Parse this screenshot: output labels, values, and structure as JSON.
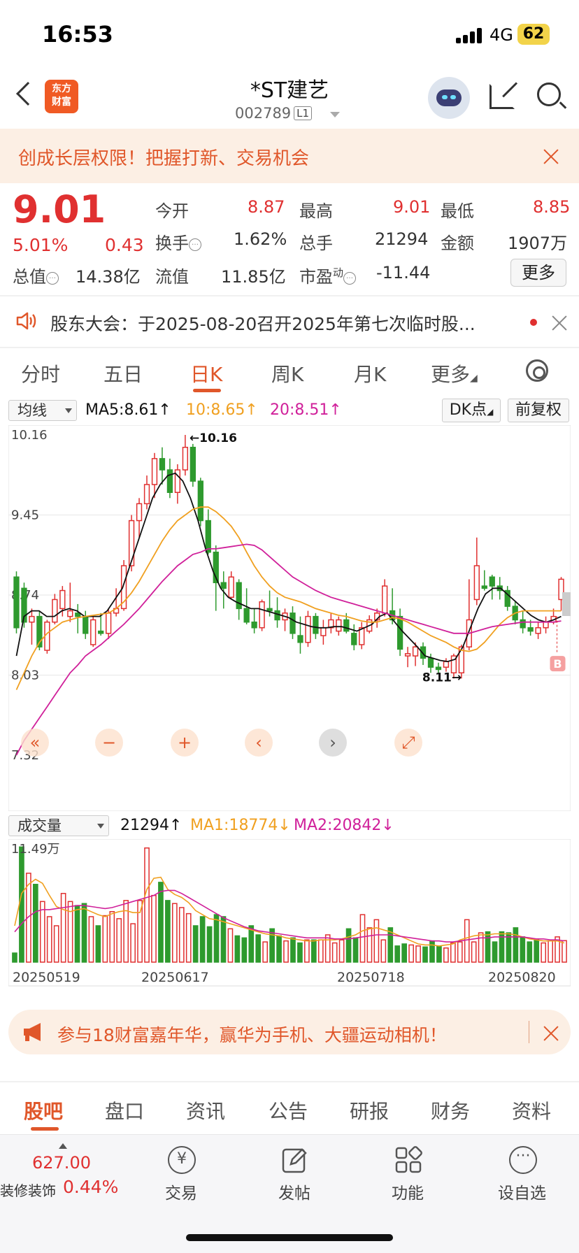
{
  "status_bar": {
    "time": "16:53",
    "network": "4G",
    "battery": "62"
  },
  "header": {
    "logo_line1": "东方",
    "logo_line2": "财富",
    "title": "*ST建艺",
    "code": "002789",
    "level": "L1"
  },
  "banner": {
    "text": "创成长层权限！把握打新、交易机会"
  },
  "quote": {
    "price": "9.01",
    "change_pct": "5.01%",
    "change": "0.43",
    "open_label": "今开",
    "open": "8.87",
    "high_label": "最高",
    "high": "9.01",
    "low_label": "最低",
    "low": "8.85",
    "turnover_label": "换手",
    "turnover": "1.62%",
    "volume_label": "总手",
    "volume": "21294",
    "amount_label": "金额",
    "amount": "1907万",
    "mktcap_label": "总值",
    "mktcap": "14.38亿",
    "float_label": "流值",
    "float": "11.85亿",
    "pe_label": "市盈",
    "pe_sup": "动",
    "pe": "-11.44",
    "more_label": "更多"
  },
  "notice": {
    "text": "股东大会：于2025-08-20召开2025年第七次临时股..."
  },
  "chart_tabs": {
    "items": [
      "分时",
      "五日",
      "日K",
      "周K",
      "月K",
      "更多"
    ],
    "active": "日K"
  },
  "ma_bar": {
    "selector": "均线",
    "ma5": "MA5:8.61↑",
    "ma10": "10:8.65↑",
    "ma20": "20:8.51↑",
    "dk_button": "DK点",
    "adjust_button": "前复权",
    "colors": {
      "ma5": "#111111",
      "ma10": "#f0a020",
      "ma20": "#d0209a",
      "up": "#e03030",
      "down": "#2e9a2e"
    }
  },
  "chart_data": [
    {
      "type": "candlestick",
      "y_ticks": [
        "10.16",
        "9.45",
        "8.74",
        "8.03",
        "7.32"
      ],
      "ylim": [
        7.32,
        10.16
      ],
      "annotations": {
        "high_label": "←10.16",
        "low_label": "8.11→",
        "signal": "B"
      },
      "controls": [
        "«",
        "−",
        "+",
        "‹",
        "›",
        "⤢"
      ],
      "candles": [
        [
          8.9,
          8.95,
          8.4,
          8.45
        ],
        [
          8.8,
          8.85,
          8.45,
          8.5
        ],
        [
          8.5,
          8.62,
          8.3,
          8.55
        ],
        [
          8.55,
          8.6,
          8.25,
          8.28
        ],
        [
          8.25,
          8.52,
          8.22,
          8.5
        ],
        [
          8.5,
          8.75,
          8.48,
          8.7
        ],
        [
          8.62,
          8.82,
          8.55,
          8.78
        ],
        [
          8.55,
          8.85,
          8.5,
          8.6
        ],
        [
          8.58,
          8.66,
          8.4,
          8.55
        ],
        [
          8.55,
          8.6,
          8.35,
          8.4
        ],
        [
          8.3,
          8.55,
          8.28,
          8.52
        ],
        [
          8.42,
          8.58,
          8.38,
          8.4
        ],
        [
          8.4,
          8.62,
          8.35,
          8.58
        ],
        [
          8.58,
          8.8,
          8.55,
          8.62
        ],
        [
          8.62,
          9.05,
          8.6,
          9.0
        ],
        [
          9.0,
          9.45,
          8.95,
          9.4
        ],
        [
          9.4,
          9.6,
          9.25,
          9.55
        ],
        [
          9.55,
          9.8,
          9.5,
          9.72
        ],
        [
          9.72,
          10.0,
          9.6,
          9.95
        ],
        [
          9.95,
          10.05,
          9.72,
          9.85
        ],
        [
          9.85,
          9.95,
          9.6,
          9.65
        ],
        [
          9.65,
          9.9,
          9.55,
          9.85
        ],
        [
          9.85,
          10.16,
          9.8,
          10.05
        ],
        [
          10.05,
          10.08,
          9.7,
          9.75
        ],
        [
          9.75,
          9.78,
          9.35,
          9.4
        ],
        [
          9.4,
          9.5,
          9.1,
          9.12
        ],
        [
          9.12,
          9.18,
          8.6,
          8.85
        ],
        [
          8.85,
          8.95,
          8.62,
          8.8
        ],
        [
          8.72,
          8.95,
          8.7,
          8.9
        ],
        [
          8.85,
          8.88,
          8.52,
          8.62
        ],
        [
          8.62,
          8.8,
          8.48,
          8.5
        ],
        [
          8.5,
          8.62,
          8.4,
          8.45
        ],
        [
          8.45,
          8.7,
          8.42,
          8.68
        ],
        [
          8.62,
          8.78,
          8.55,
          8.6
        ],
        [
          8.6,
          8.72,
          8.45,
          8.52
        ],
        [
          8.52,
          8.62,
          8.42,
          8.58
        ],
        [
          8.58,
          8.64,
          8.35,
          8.4
        ],
        [
          8.38,
          8.55,
          8.22,
          8.32
        ],
        [
          8.32,
          8.6,
          8.28,
          8.55
        ],
        [
          8.55,
          8.58,
          8.35,
          8.4
        ],
        [
          8.38,
          8.52,
          8.3,
          8.45
        ],
        [
          8.45,
          8.58,
          8.4,
          8.52
        ],
        [
          8.42,
          8.55,
          8.38,
          8.52
        ],
        [
          8.52,
          8.58,
          8.4,
          8.42
        ],
        [
          8.4,
          8.48,
          8.25,
          8.3
        ],
        [
          8.3,
          8.5,
          8.26,
          8.45
        ],
        [
          8.42,
          8.56,
          8.4,
          8.52
        ],
        [
          8.52,
          8.62,
          8.45,
          8.58
        ],
        [
          8.58,
          8.88,
          8.55,
          8.82
        ],
        [
          8.6,
          8.8,
          8.48,
          8.52
        ],
        [
          8.55,
          8.62,
          8.2,
          8.26
        ],
        [
          8.2,
          8.28,
          8.1,
          8.22
        ],
        [
          8.2,
          8.32,
          8.11,
          8.28
        ],
        [
          8.28,
          8.32,
          8.12,
          8.18
        ],
        [
          8.18,
          8.22,
          8.05,
          8.1
        ],
        [
          8.1,
          8.14,
          8.05,
          8.08
        ],
        [
          8.1,
          8.18,
          8.06,
          8.15
        ],
        [
          8.05,
          8.22,
          8.0,
          8.2
        ],
        [
          8.05,
          8.3,
          8.0,
          8.28
        ],
        [
          8.28,
          8.88,
          8.25,
          8.52
        ],
        [
          8.7,
          9.25,
          8.65,
          9.0
        ],
        [
          8.82,
          8.96,
          8.78,
          8.8
        ],
        [
          8.9,
          8.92,
          8.7,
          8.82
        ],
        [
          8.82,
          8.9,
          8.7,
          8.78
        ],
        [
          8.78,
          8.82,
          8.6,
          8.64
        ],
        [
          8.64,
          8.68,
          8.48,
          8.52
        ],
        [
          8.52,
          8.6,
          8.4,
          8.45
        ],
        [
          8.45,
          8.52,
          8.38,
          8.42
        ],
        [
          8.4,
          8.5,
          8.35,
          8.45
        ],
        [
          8.45,
          8.55,
          8.4,
          8.5
        ],
        [
          8.5,
          8.62,
          8.48,
          8.55
        ],
        [
          8.7,
          8.9,
          8.6,
          8.88
        ]
      ],
      "series": [
        {
          "name": "MA5",
          "values": [
            8.2,
            8.55,
            8.6,
            8.6,
            8.55,
            8.55,
            8.6,
            8.62,
            8.6,
            8.55,
            8.55,
            8.55,
            8.6,
            8.7,
            8.8,
            9.0,
            9.2,
            9.4,
            9.6,
            9.72,
            9.8,
            9.82,
            9.75,
            9.6,
            9.4,
            9.15,
            8.95,
            8.8,
            8.72,
            8.68,
            8.65,
            8.62,
            8.62,
            8.6,
            8.58,
            8.56,
            8.54,
            8.5,
            8.48,
            8.46,
            8.45,
            8.45,
            8.46,
            8.46,
            8.44,
            8.42,
            8.45,
            8.48,
            8.55,
            8.58,
            8.5,
            8.42,
            8.35,
            8.28,
            8.2,
            8.18,
            8.16,
            8.15,
            8.17,
            8.28,
            8.45,
            8.62,
            8.75,
            8.8,
            8.8,
            8.74,
            8.68,
            8.62,
            8.56,
            8.52,
            8.5,
            8.52,
            8.55
          ]
        },
        {
          "name": "MA10",
          "values": [
            7.9,
            8.05,
            8.2,
            8.32,
            8.4,
            8.45,
            8.5,
            8.52,
            8.54,
            8.55,
            8.56,
            8.57,
            8.58,
            8.62,
            8.68,
            8.76,
            8.86,
            8.98,
            9.1,
            9.22,
            9.32,
            9.4,
            9.45,
            9.5,
            9.52,
            9.52,
            9.48,
            9.42,
            9.35,
            9.25,
            9.12,
            9.0,
            8.9,
            8.82,
            8.76,
            8.72,
            8.7,
            8.68,
            8.65,
            8.62,
            8.6,
            8.58,
            8.56,
            8.55,
            8.53,
            8.51,
            8.5,
            8.5,
            8.52,
            8.54,
            8.53,
            8.5,
            8.46,
            8.42,
            8.38,
            8.35,
            8.32,
            8.28,
            8.25,
            8.24,
            8.26,
            8.32,
            8.4,
            8.48,
            8.54,
            8.58,
            8.6,
            8.6,
            8.6,
            8.6,
            8.6,
            8.6
          ]
        },
        {
          "name": "MA20",
          "values": [
            7.32,
            7.45,
            7.55,
            7.65,
            7.75,
            7.85,
            7.95,
            8.05,
            8.12,
            8.2,
            8.25,
            8.3,
            8.36,
            8.42,
            8.48,
            8.55,
            8.62,
            8.7,
            8.78,
            8.86,
            8.93,
            9.0,
            9.05,
            9.1,
            9.12,
            9.15,
            9.15,
            9.16,
            9.17,
            9.18,
            9.19,
            9.18,
            9.14,
            9.08,
            9.02,
            8.96,
            8.9,
            8.86,
            8.82,
            8.78,
            8.75,
            8.72,
            8.7,
            8.68,
            8.66,
            8.64,
            8.62,
            8.6,
            8.58,
            8.56,
            8.54,
            8.52,
            8.5,
            8.48,
            8.46,
            8.44,
            8.42,
            8.4,
            8.4,
            8.4,
            8.42,
            8.44,
            8.46,
            8.47,
            8.48,
            8.49,
            8.5,
            8.5,
            8.5,
            8.5,
            8.5,
            8.51
          ]
        }
      ]
    },
    {
      "type": "bar",
      "title": "成交量",
      "legend": {
        "volume": "21294↑",
        "ma1": "MA1:18774↓",
        "ma2": "MA2:20842↓"
      },
      "y_tick": "11.49万",
      "ylim": [
        0,
        114900
      ],
      "x_ticks": [
        "20250519",
        "20250617",
        "20250718",
        "20250820"
      ],
      "values": [
        9000,
        114000,
        88000,
        77000,
        60000,
        45000,
        36000,
        68000,
        60000,
        56000,
        58000,
        45000,
        36000,
        46000,
        50000,
        43000,
        61000,
        38000,
        61000,
        113000,
        66000,
        79000,
        61000,
        58000,
        54000,
        48000,
        36000,
        45000,
        35000,
        47000,
        45000,
        33000,
        26000,
        24000,
        36000,
        27000,
        20000,
        33000,
        26000,
        21000,
        24000,
        19000,
        22000,
        22000,
        22000,
        27000,
        19000,
        22000,
        33000,
        24000,
        47000,
        34000,
        42000,
        22000,
        34000,
        16000,
        18000,
        17000,
        16000,
        15000,
        21000,
        16000,
        14000,
        19000,
        20000,
        42000,
        20000,
        29000,
        30000,
        20000,
        30000,
        29000,
        34000,
        25000,
        20000,
        22000,
        19000,
        21000,
        25000,
        21294
      ],
      "series": [
        {
          "name": "MA1",
          "values": [
            36000,
            68000,
            77000,
            82000,
            78000,
            66000,
            55000,
            52000,
            50000,
            52000,
            53000,
            50000,
            47000,
            45000,
            48000,
            50000,
            51000,
            49000,
            49000,
            72000,
            83000,
            84000,
            72000,
            67000,
            64000,
            59000,
            51000,
            47000,
            43000,
            42000,
            40000,
            38000,
            36000,
            34000,
            32000,
            30000,
            28000,
            27000,
            26000,
            24000,
            23000,
            22000,
            21000,
            21000,
            22000,
            22000,
            22000,
            23000,
            25000,
            27000,
            31000,
            33000,
            34000,
            32000,
            30000,
            27000,
            24000,
            21000,
            18000,
            17000,
            17000,
            16000,
            17000,
            18000,
            22000,
            24000,
            26000,
            27000,
            27000,
            28000,
            28000,
            28000,
            27000,
            25000,
            23000,
            22000,
            21000,
            21000,
            21000,
            19000
          ]
        },
        {
          "name": "MA2",
          "values": [
            30000,
            38000,
            45000,
            50000,
            52000,
            52000,
            53000,
            54000,
            55000,
            56000,
            56000,
            55000,
            54000,
            53000,
            54000,
            56000,
            58000,
            60000,
            62000,
            64000,
            66000,
            70000,
            71000,
            71000,
            68000,
            64000,
            60000,
            56000,
            52000,
            48000,
            44000,
            41000,
            38000,
            35000,
            33000,
            31000,
            30000,
            29000,
            28000,
            27000,
            26000,
            25000,
            24000,
            24000,
            24000,
            24000,
            23000,
            23000,
            23000,
            24000,
            25000,
            26000,
            27000,
            27000,
            27000,
            26000,
            25000,
            24000,
            23000,
            22000,
            21000,
            21000,
            20000,
            20000,
            21000,
            22000,
            23000,
            24000,
            24000,
            25000,
            25000,
            25000,
            25000,
            25000,
            24000,
            23000,
            23000,
            22000,
            22000,
            21000
          ]
        }
      ]
    }
  ],
  "ad": {
    "text": "参与18财富嘉年华，赢华为手机、大疆运动相机！"
  },
  "bottom_tabs": {
    "items": [
      "股吧",
      "盘口",
      "资讯",
      "公告",
      "研报",
      "财务",
      "资料"
    ],
    "active": "股吧"
  },
  "bottom_bar": {
    "index_value": "627.00",
    "index_name": "装修装饰",
    "index_pct": "0.44%",
    "trade": "交易",
    "trade_icon": "¥",
    "post": "发帖",
    "func": "功能",
    "watchlist": "设自选"
  }
}
